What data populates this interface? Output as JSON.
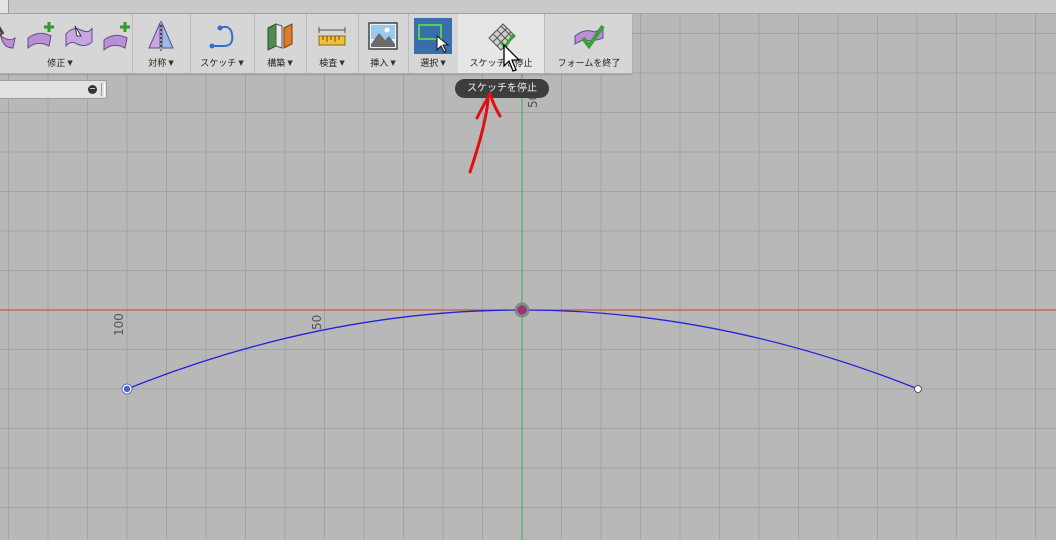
{
  "toolbar": {
    "groups": [
      {
        "label": "修正",
        "icons": [
          "pliers-icon",
          "add-surface-icon",
          "edit-face-icon",
          "add-face-icon"
        ]
      },
      {
        "label": "対称",
        "icons": [
          "symmetry-icon"
        ]
      },
      {
        "label": "スケッチ",
        "icons": [
          "sketch-curve-icon"
        ]
      },
      {
        "label": "構築",
        "icons": [
          "construct-plane-icon"
        ]
      },
      {
        "label": "検査",
        "icons": [
          "ruler-icon"
        ]
      },
      {
        "label": "挿入",
        "icons": [
          "insert-image-icon"
        ]
      },
      {
        "label": "選択",
        "icons": [
          "select-window-icon"
        ]
      },
      {
        "label": "スケッチを停止",
        "icons": [
          "stop-sketch-icon"
        ]
      },
      {
        "label": "フォームを終了",
        "icons": [
          "finish-form-icon"
        ]
      }
    ]
  },
  "tooltip": {
    "text": "スケッチを停止"
  },
  "viewport": {
    "axis_labels": {
      "top": "50",
      "left_100": "100",
      "left_50": "50"
    },
    "colors": {
      "background": "#b8b8b8",
      "grid": "#a4a4a4",
      "x_axis": "#c8442a",
      "y_axis": "#3fae55",
      "curve": "#2222dd",
      "annotation": "#e01010"
    }
  }
}
